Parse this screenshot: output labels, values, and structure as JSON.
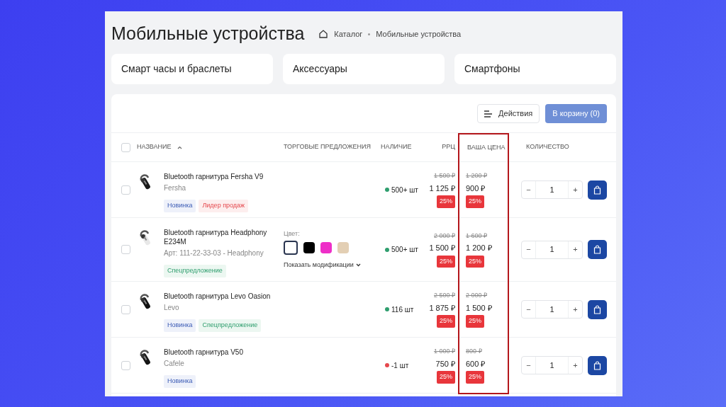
{
  "page": {
    "title": "Мобильные устройства",
    "breadcrumbs": [
      "Каталог",
      "Мобильные устройства"
    ]
  },
  "categories": [
    "Смарт часы и браслеты",
    "Аксессуары",
    "Смартфоны"
  ],
  "toolbar": {
    "actions_button": "Действия",
    "cart_button": "В корзину (0)"
  },
  "table": {
    "select_all_checked": false,
    "columns": [
      {
        "label": "НАЗВАНИЕ",
        "sorted": true,
        "highlighted": false
      },
      {
        "label": "ТОРГОВЫЕ ПРЕДЛОЖЕНИЯ",
        "sorted": false,
        "highlighted": false
      },
      {
        "label": "НАЛИЧИЕ",
        "sorted": false,
        "highlighted": false
      },
      {
        "label": "РРЦ",
        "sorted": false,
        "highlighted": false
      },
      {
        "label": "ВАША ЦЕНА",
        "sorted": false,
        "highlighted": true
      },
      {
        "label": "КОЛИЧЕСТВО",
        "sorted": false,
        "highlighted": false
      }
    ],
    "rows": [
      {
        "checked": false,
        "image": {
          "kind": "picture"
        },
        "name": "Bluetooth гарнитура Fersha V9",
        "subtitle": "Fersha",
        "tags": [
          {
            "label": "Новинка",
            "kind": "new"
          },
          {
            "label": "Лидер продаж",
            "kind": "bestseller"
          }
        ],
        "stock": {
          "text": "500+ шт",
          "color": "#2f9e6e"
        },
        "rrp": {
          "old": "1 500 ₽",
          "price": "1 125 ₽",
          "discount": "25%"
        },
        "your_price": {
          "old": "1 200 ₽",
          "price": "900 ₽",
          "discount": "25%"
        },
        "quantity": {
          "minus": "−",
          "value": "1",
          "plus": "+"
        }
      },
      {
        "checked": false,
        "image": {
          "kind": "picture"
        },
        "name": "Bluetooth гарнитура Headphony E234M",
        "subtitle": "Арт: 111-22-33-03 - Headphony",
        "tags": [
          {
            "label": "Спецпредложение",
            "kind": "special"
          }
        ],
        "offers": {
          "label": "Цвет:",
          "swatches": [
            {
              "color": "#ffffff",
              "selected": true
            },
            {
              "color": "#000000",
              "selected": false
            },
            {
              "color": "#ee2fc8",
              "selected": false
            },
            {
              "color": "#e3cfb4",
              "selected": false
            }
          ],
          "link": "Показать модификации"
        },
        "stock": {
          "text": "500+ шт",
          "color": "#2f9e6e"
        },
        "rrp": {
          "old": "2 000 ₽",
          "price": "1 500 ₽",
          "discount": "25%"
        },
        "your_price": {
          "old": "1 600 ₽",
          "price": "1 200 ₽",
          "discount": "25%"
        },
        "quantity": {
          "minus": "−",
          "value": "1",
          "plus": "+"
        }
      },
      {
        "checked": false,
        "image": {
          "kind": "picture"
        },
        "name": "Bluetooth гарнитура Levo Oasion",
        "subtitle": "Levo",
        "tags": [
          {
            "label": "Новинка",
            "kind": "new"
          },
          {
            "label": "Спецпредложение",
            "kind": "special"
          }
        ],
        "stock": {
          "text": "116 шт",
          "color": "#2f9e6e"
        },
        "rrp": {
          "old": "2 500 ₽",
          "price": "1 875 ₽",
          "discount": "25%"
        },
        "your_price": {
          "old": "2 000 ₽",
          "price": "1 500 ₽",
          "discount": "25%"
        },
        "quantity": {
          "minus": "−",
          "value": "1",
          "plus": "+"
        }
      },
      {
        "checked": false,
        "image": {
          "kind": "picture"
        },
        "name": "Bluetooth гарнитура V50",
        "subtitle": "Cafele",
        "tags": [
          {
            "label": "Новинка",
            "kind": "new"
          }
        ],
        "stock": {
          "text": "-1 шт",
          "color": "#e5484d"
        },
        "rrp": {
          "old": "1 000 ₽",
          "price": "750 ₽",
          "discount": "25%"
        },
        "your_price": {
          "old": "800 ₽",
          "price": "600 ₽",
          "discount": "25%"
        },
        "quantity": {
          "minus": "−",
          "value": "1",
          "plus": "+"
        }
      }
    ]
  }
}
